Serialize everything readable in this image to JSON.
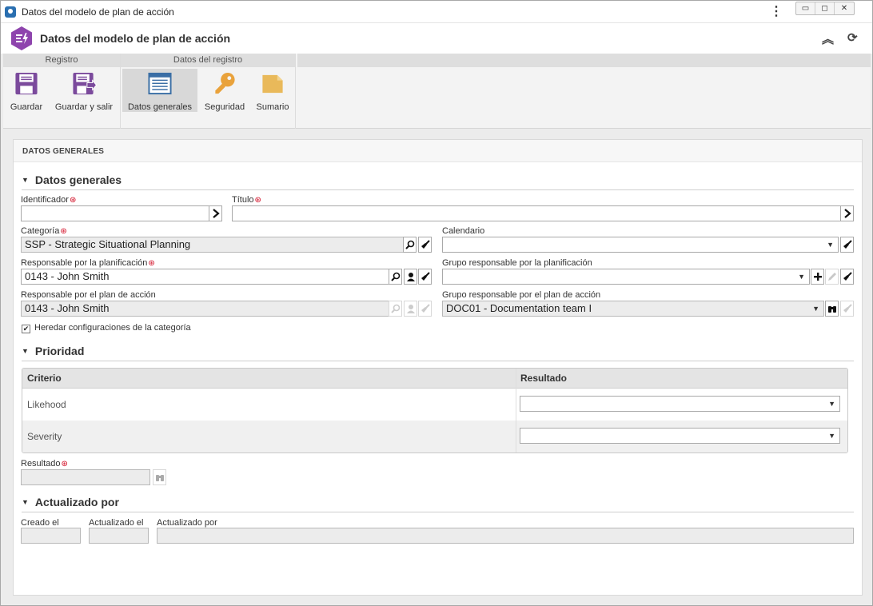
{
  "window": {
    "title": "Datos del modelo de plan de acción"
  },
  "header": {
    "title": "Datos del modelo de plan de acción"
  },
  "ribbon": {
    "groups": [
      {
        "label": "Registro"
      },
      {
        "label": "Datos del registro"
      }
    ],
    "buttons": [
      {
        "label": "Guardar",
        "icon": "save-icon"
      },
      {
        "label": "Guardar y salir",
        "icon": "save-exit-icon"
      },
      {
        "label": "Datos generales",
        "icon": "form-icon"
      },
      {
        "label": "Seguridad",
        "icon": "key-icon"
      },
      {
        "label": "Sumario",
        "icon": "folder-icon"
      }
    ]
  },
  "panel": {
    "title": "DATOS GENERALES"
  },
  "general": {
    "section": "Datos generales",
    "identificador": {
      "label": "Identificador",
      "value": ""
    },
    "titulo": {
      "label": "Título",
      "value": ""
    },
    "categoria": {
      "label": "Categoría",
      "value": "SSP - Strategic Situational Planning"
    },
    "calendario": {
      "label": "Calendario",
      "value": ""
    },
    "resp_planificacion": {
      "label": "Responsable por la planificación",
      "value": "0143 - John Smith"
    },
    "grupo_planificacion": {
      "label": "Grupo responsable por la planificación",
      "value": ""
    },
    "resp_plan": {
      "label": "Responsable por el plan de acción",
      "value": "0143 - John Smith"
    },
    "grupo_plan": {
      "label": "Grupo responsable por el plan de acción",
      "value": "DOC01 - Documentation team I"
    },
    "heredar": {
      "label": "Heredar configuraciones de la categoría",
      "checked": true
    }
  },
  "priority": {
    "section": "Prioridad",
    "columns": [
      "Criterio",
      "Resultado"
    ],
    "rows": [
      {
        "criterio": "Likehood",
        "resultado": ""
      },
      {
        "criterio": "Severity",
        "resultado": ""
      }
    ],
    "resultado": {
      "label": "Resultado",
      "value": ""
    }
  },
  "updated": {
    "section": "Actualizado por",
    "creado_el": {
      "label": "Creado el",
      "value": ""
    },
    "actualizado_el": {
      "label": "Actualizado el",
      "value": ""
    },
    "actualizado_por": {
      "label": "Actualizado por",
      "value": ""
    }
  },
  "colors": {
    "brand": "#8e44ad",
    "ribbon_icon": "#7b4a9c",
    "key_icon": "#e9a23b",
    "required": "#d0021b"
  }
}
